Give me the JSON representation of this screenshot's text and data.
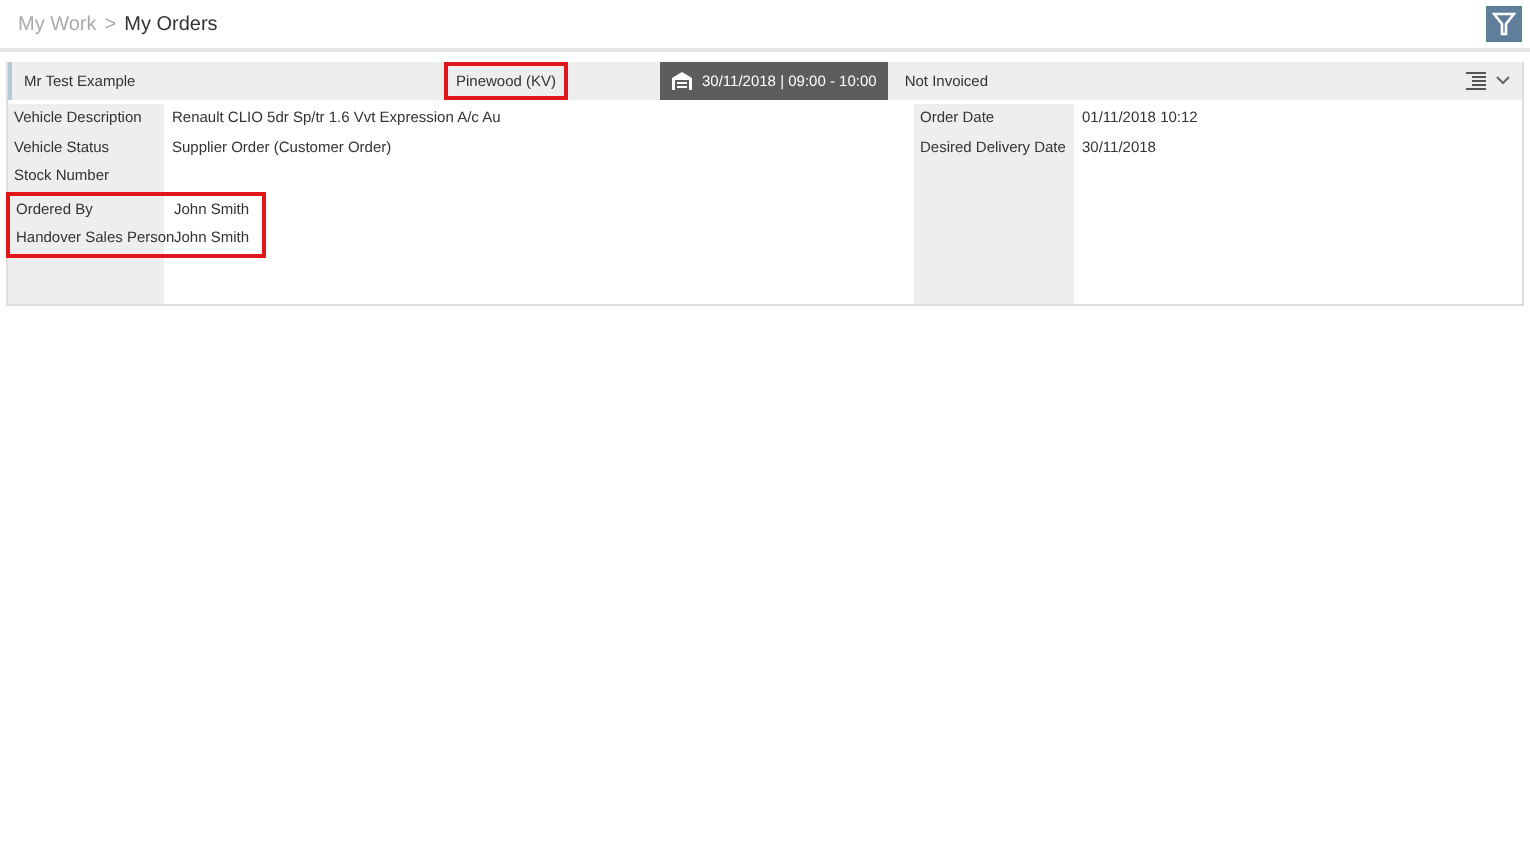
{
  "breadcrumb": {
    "parent": "My Work",
    "separator": ">",
    "current": "My Orders"
  },
  "order": {
    "customer": "Mr Test Example",
    "location": {
      "text": "Pinewood (KV)",
      "highlighted": true
    },
    "appointment": "30/11/2018 | 09:00 - 10:00",
    "invoice_status": "Not Invoiced",
    "left_fields": [
      {
        "label": "Vehicle Description",
        "value": "Renault CLIO 5dr Sp/tr 1.6 Vvt Expression A/c Au",
        "highlighted": false
      },
      {
        "label": "Vehicle Status",
        "value": "Supplier Order (Customer Order)",
        "highlighted": false
      },
      {
        "label": "Stock Number",
        "highlighted": false
      },
      {
        "label": "Ordered By",
        "value": "John Smith",
        "highlighted": true
      },
      {
        "label": "Handover Sales Person",
        "value": "John Smith",
        "highlighted": true
      }
    ],
    "right_fields": [
      {
        "label": "Order Date",
        "value": "01/11/2018 10:12"
      },
      {
        "label": "Desired Delivery Date",
        "value": "30/11/2018"
      }
    ]
  }
}
